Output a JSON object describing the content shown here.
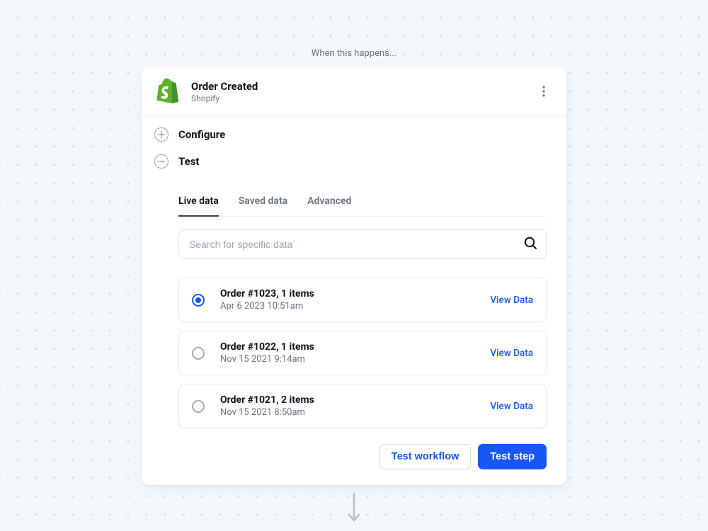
{
  "headline": "When this happens...",
  "header": {
    "title": "Order Created",
    "subtitle": "Shopify",
    "icon": "shopify-icon"
  },
  "sections": {
    "configure": {
      "label": "Configure"
    },
    "test": {
      "label": "Test"
    }
  },
  "tabs": [
    {
      "label": "Live data",
      "active": true
    },
    {
      "label": "Saved data",
      "active": false
    },
    {
      "label": "Advanced",
      "active": false
    }
  ],
  "search": {
    "placeholder": "Search for specific data"
  },
  "orders": [
    {
      "title": "Order #1023, 1 items",
      "date": "Apr 6 2023 10:51am",
      "selected": true,
      "view_label": "View Data"
    },
    {
      "title": "Order #1022, 1 items",
      "date": "Nov 15 2021 9:14am",
      "selected": false,
      "view_label": "View Data"
    },
    {
      "title": "Order #1021, 2 items",
      "date": "Nov 15 2021 8:50am",
      "selected": false,
      "view_label": "View Data"
    }
  ],
  "actions": {
    "test_workflow": "Test workflow",
    "test_step": "Test step"
  },
  "colors": {
    "accent": "#1856F5",
    "brand_green": "#5CB02C"
  }
}
